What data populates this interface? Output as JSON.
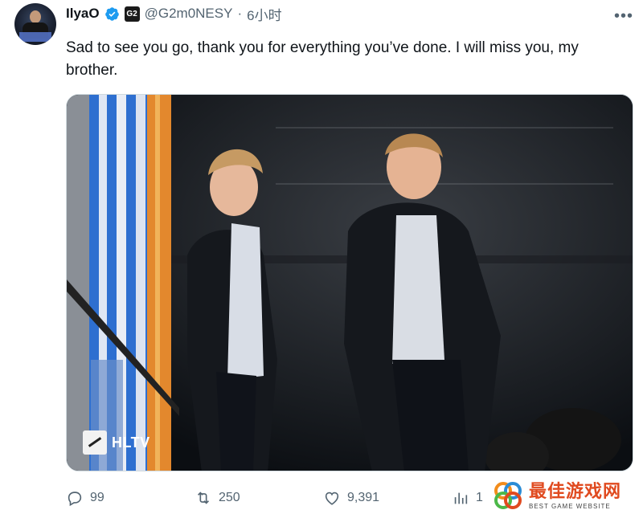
{
  "author": {
    "display_name": "IlyaO",
    "handle": "@G2m0NESY",
    "separator": "·",
    "time": "6小时",
    "affiliate_label": "G2"
  },
  "tweet": {
    "text": "Sad to see you go, thank you for everything you’ve done. I will miss you, my brother."
  },
  "media": {
    "watermark": "HLTV"
  },
  "actions": {
    "replies": "99",
    "retweets": "250",
    "likes": "9,391",
    "views": "1"
  },
  "overlay": {
    "site_name": "最佳游戏网",
    "site_tagline": "BEST GAME WEBSITE"
  },
  "colors": {
    "verified": "#1d9bf0",
    "text_secondary": "#536471",
    "watermark_accent": "#e04a1f"
  }
}
